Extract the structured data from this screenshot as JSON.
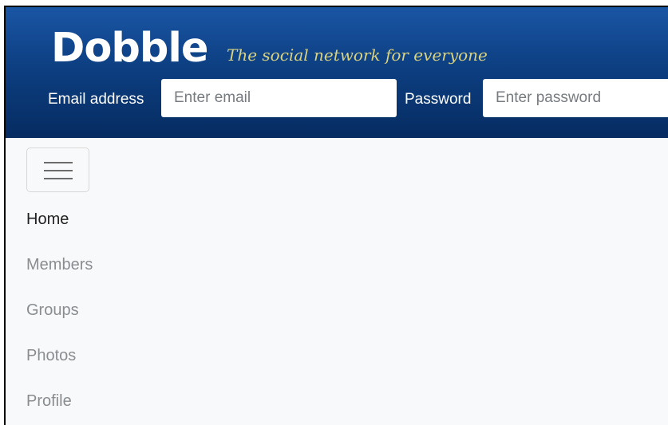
{
  "brand": {
    "name": "Dobble",
    "tagline": "The social network for everyone"
  },
  "login": {
    "email_label": "Email address",
    "email_placeholder": "Enter email",
    "password_label": "Password",
    "password_placeholder": "Enter password"
  },
  "nav": {
    "toggle_icon": "hamburger-menu-icon",
    "items": [
      {
        "label": "Home",
        "active": true
      },
      {
        "label": "Members",
        "active": false
      },
      {
        "label": "Groups",
        "active": false
      },
      {
        "label": "Photos",
        "active": false
      },
      {
        "label": "Profile",
        "active": false
      }
    ]
  },
  "colors": {
    "header_top": "#1a56a5",
    "header_bottom": "#062c61",
    "tagline": "#d9d27e",
    "nav_background": "#f8f9fa",
    "nav_active": "#222222",
    "nav_inactive": "#8a8d90"
  }
}
